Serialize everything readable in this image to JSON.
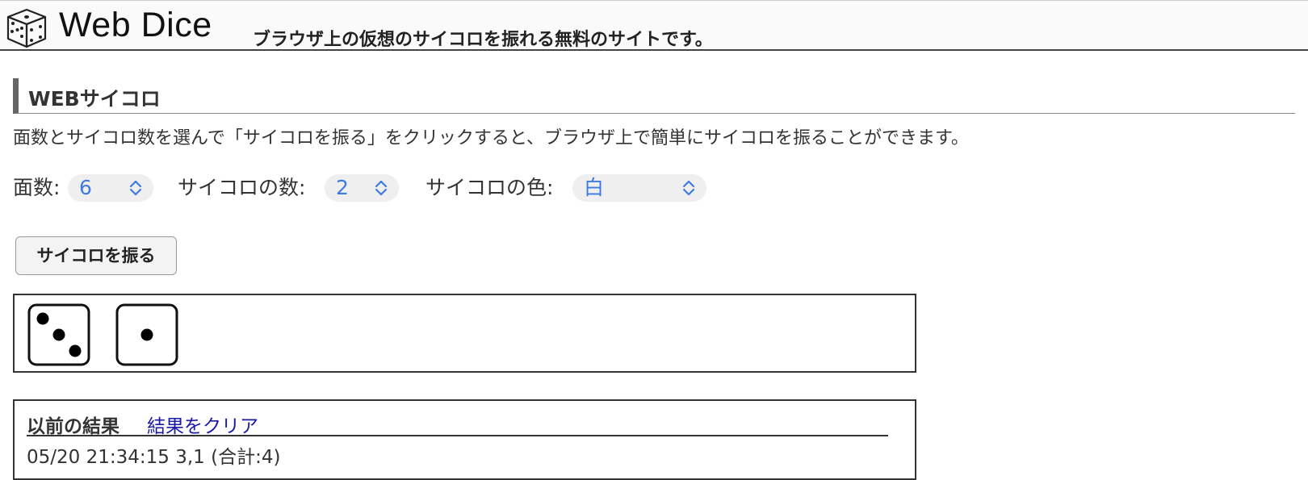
{
  "header": {
    "site_title": "Web Dice",
    "tagline": "ブラウザ上の仮想のサイコロを振れる無料のサイトです。",
    "logo_icon": "dice-icon"
  },
  "section": {
    "heading": "WEBサイコロ",
    "description": "面数とサイコロ数を選んで「サイコロを振る」をクリックすると、ブラウザ上で簡単にサイコロを振ることができます。"
  },
  "controls": {
    "faces_label": "面数:",
    "faces_value": "6",
    "count_label": "サイコロの数:",
    "count_value": "2",
    "color_label": "サイコロの色:",
    "color_value": "白",
    "select_icon": "chevron-up-down-icon",
    "select_text_color": "#3d7be0"
  },
  "roll_button": {
    "label": "サイコロを振る"
  },
  "dice_result": {
    "faces": [
      3,
      1
    ],
    "die_color": "#ffffff",
    "pip_color": "#000000"
  },
  "history": {
    "title": "以前の結果",
    "clear_label": "結果をクリア",
    "rows": [
      "05/20 21:34:15  3,1   (合計:4)"
    ]
  }
}
